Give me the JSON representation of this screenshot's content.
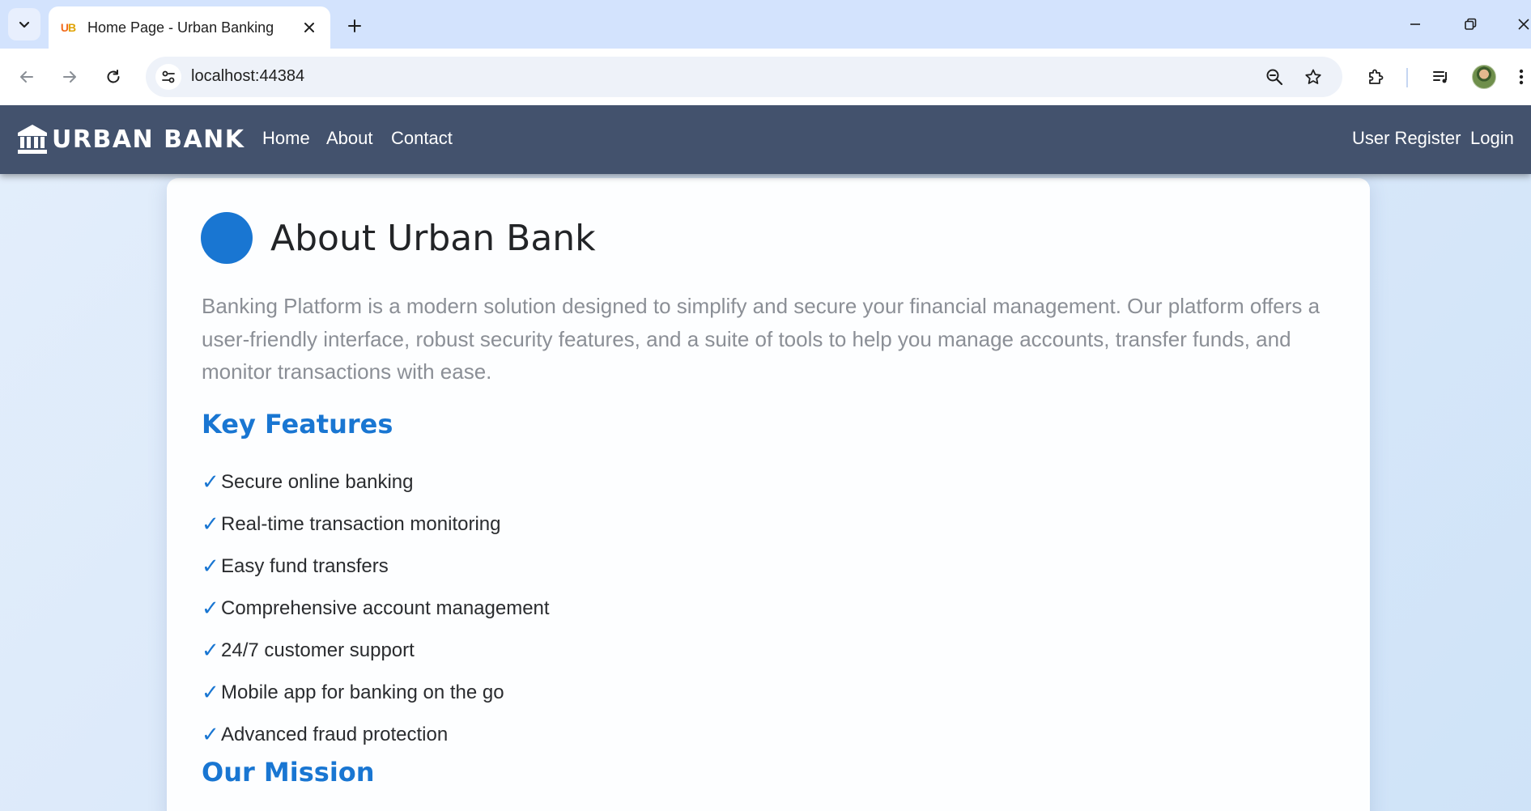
{
  "browser": {
    "tab": {
      "title": "Home Page - Urban Banking",
      "favicon_text": "UB"
    },
    "address_bar": {
      "url": "localhost:44384"
    }
  },
  "navbar": {
    "brand": "URBAN BANK",
    "links": [
      "Home",
      "About",
      "Contact"
    ],
    "right_links": [
      "User Register",
      "Login"
    ]
  },
  "about": {
    "title": "About Urban Bank",
    "intro": "Banking Platform is a modern solution designed to simplify and secure your financial management. Our platform offers a user-friendly interface, robust security features, and a suite of tools to help you manage accounts, transfer funds, and monitor transactions with ease.",
    "features_heading": "Key Features",
    "check_mark": "✓",
    "features": [
      "Secure online banking",
      "Real-time transaction monitoring",
      "Easy fund transfers",
      "Comprehensive account management",
      "24/7 customer support",
      "Mobile app for banking on the go",
      "Advanced fraud protection"
    ],
    "mission_heading": "Our Mission"
  },
  "colors": {
    "accent": "#1976d2",
    "navbar_bg": "#43526d",
    "chrome_bg": "#d3e3fd"
  }
}
